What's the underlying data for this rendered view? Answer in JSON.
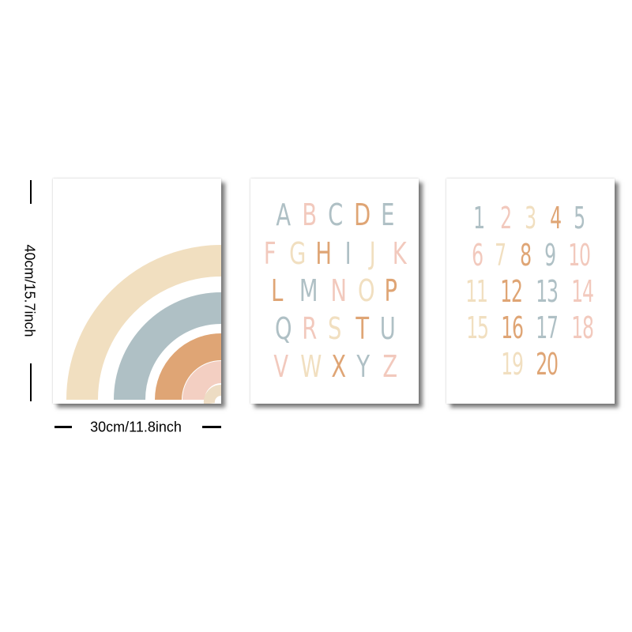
{
  "dimensions": {
    "height": "40cm/15.7inch",
    "width": "30cm/11.8inch"
  },
  "palette": {
    "sand": "#f1dfc0",
    "blue": "#afc0c5",
    "orange": "#dfa575",
    "pink": "#f3cfc2",
    "cream": "#eddcc3"
  },
  "alphabet": {
    "rows": [
      [
        {
          "c": "A",
          "color": "#afc0c5"
        },
        {
          "c": "B",
          "color": "#f2c9bd"
        },
        {
          "c": "C",
          "color": "#afc0c5"
        },
        {
          "c": "D",
          "color": "#dfa575"
        },
        {
          "c": "E",
          "color": "#afc0c5"
        }
      ],
      [
        {
          "c": "F",
          "color": "#f2c9bd"
        },
        {
          "c": "G",
          "color": "#f1dfc0"
        },
        {
          "c": "H",
          "color": "#dfa575"
        },
        {
          "c": "I",
          "color": "#afc0c5"
        },
        {
          "c": "J",
          "color": "#f1dfc0"
        },
        {
          "c": "K",
          "color": "#f2c9bd"
        }
      ],
      [
        {
          "c": "L",
          "color": "#dfa575"
        },
        {
          "c": "M",
          "color": "#afc0c5"
        },
        {
          "c": "N",
          "color": "#f2c9bd"
        },
        {
          "c": "O",
          "color": "#f1dfc0"
        },
        {
          "c": "P",
          "color": "#dfa575"
        }
      ],
      [
        {
          "c": "Q",
          "color": "#afc0c5"
        },
        {
          "c": "R",
          "color": "#f2c9bd"
        },
        {
          "c": "S",
          "color": "#f1dfc0"
        },
        {
          "c": "T",
          "color": "#dfa575"
        },
        {
          "c": "U",
          "color": "#afc0c5"
        }
      ],
      [
        {
          "c": "V",
          "color": "#f2c9bd"
        },
        {
          "c": "W",
          "color": "#f1dfc0"
        },
        {
          "c": "X",
          "color": "#dfa575"
        },
        {
          "c": "Y",
          "color": "#afc0c5"
        },
        {
          "c": "Z",
          "color": "#f2c9bd"
        }
      ]
    ]
  },
  "numbers": {
    "rows": [
      [
        {
          "c": "1",
          "color": "#afc0c5"
        },
        {
          "c": "2",
          "color": "#f2c9bd"
        },
        {
          "c": "3",
          "color": "#f1dfc0"
        },
        {
          "c": "4",
          "color": "#dfa575"
        },
        {
          "c": "5",
          "color": "#afc0c5"
        }
      ],
      [
        {
          "c": "6",
          "color": "#f2c9bd"
        },
        {
          "c": "7",
          "color": "#f1dfc0"
        },
        {
          "c": "8",
          "color": "#dfa575"
        },
        {
          "c": "9",
          "color": "#afc0c5"
        },
        {
          "c": "10",
          "color": "#f2c9bd"
        }
      ],
      [
        {
          "c": "11",
          "color": "#f1dfc0"
        },
        {
          "c": "12",
          "color": "#dfa575"
        },
        {
          "c": "13",
          "color": "#afc0c5"
        },
        {
          "c": "14",
          "color": "#f2c9bd"
        }
      ],
      [
        {
          "c": "15",
          "color": "#f1dfc0"
        },
        {
          "c": "16",
          "color": "#dfa575"
        },
        {
          "c": "17",
          "color": "#afc0c5"
        },
        {
          "c": "18",
          "color": "#f2c9bd"
        }
      ],
      [
        {
          "c": "19",
          "color": "#f1dfc0"
        },
        {
          "c": "20",
          "color": "#dfa575"
        }
      ]
    ]
  }
}
